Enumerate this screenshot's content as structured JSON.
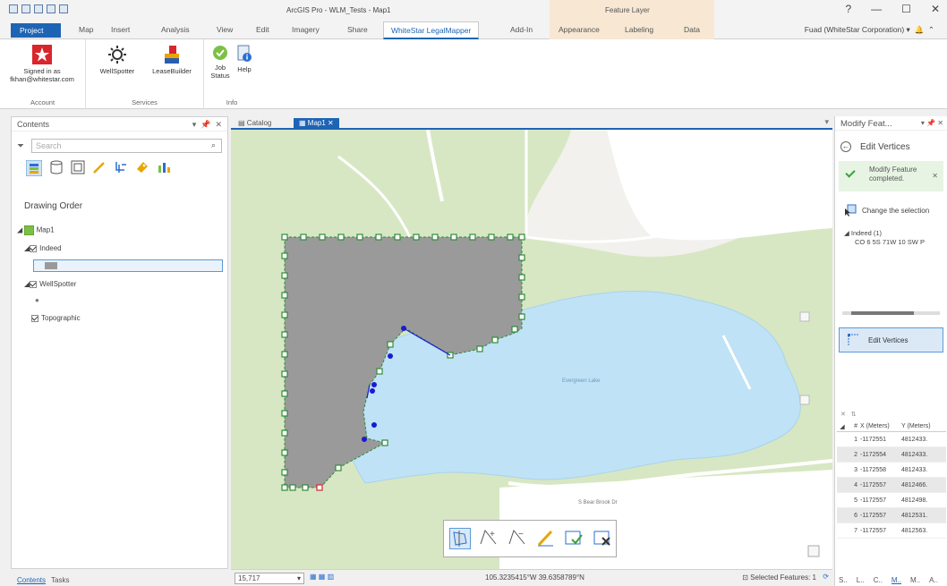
{
  "app": {
    "title": "ArcGIS Pro - WLM_Tests - Map1",
    "context_tab_group": "Feature Layer",
    "user": "Fuad (WhiteStar Corporation)",
    "window_buttons": [
      "?",
      "—",
      "☐",
      "✕"
    ]
  },
  "ribbon": {
    "tabs": [
      "Project",
      "Map",
      "Insert",
      "Analysis",
      "View",
      "Edit",
      "Imagery",
      "Share",
      "WhiteStar LegalMapper",
      "Add-In",
      "Appearance",
      "Labeling",
      "Data"
    ],
    "active_tab": "WhiteStar LegalMapper",
    "groups": {
      "account": {
        "label": "Account",
        "signed_in": "Signed in as",
        "email": "fkhan@whitestar.com"
      },
      "services": {
        "label": "Services",
        "wellspotter": "WellSpotter",
        "leasebuilder": "LeaseBuilder"
      },
      "info": {
        "label": "Info",
        "job_status": "Job Status",
        "help": "Help"
      }
    }
  },
  "contents": {
    "title": "Contents",
    "search_placeholder": "Search",
    "section": "Drawing Order",
    "layers": {
      "map": "Map1",
      "indeed": "Indeed",
      "wellspotter": "WellSpotter",
      "topographic": "Topographic"
    },
    "bottom_tabs": [
      "Contents",
      "Tasks"
    ]
  },
  "map": {
    "tabs": [
      "Catalog",
      "Map1"
    ],
    "active_tab": "Map1",
    "lake_label": "Evergreen Lake",
    "road_label": "S Bear Brook Dr"
  },
  "statusbar": {
    "scale": "15,717",
    "coords": "105.3235415°W 39.6358789°N",
    "selected": "Selected Features: 1"
  },
  "modify": {
    "title": "Modify Feat...",
    "tool": "Edit Vertices",
    "message": "Modify Feature completed.",
    "change_selection": "Change the selection",
    "tree_label": "Indeed (1)",
    "tree_value": "CO 6 5S 71W 10 SW P",
    "edit_button": "Edit Vertices",
    "grid": {
      "headers": [
        "#",
        "X (Meters)",
        "Y (Meters)"
      ],
      "rows": [
        [
          "1",
          "-1172551",
          "4812433."
        ],
        [
          "2",
          "-1172554",
          "4812433."
        ],
        [
          "3",
          "-1172558",
          "4812433."
        ],
        [
          "4",
          "-1172557",
          "4812466."
        ],
        [
          "5",
          "-1172557",
          "4812498."
        ],
        [
          "6",
          "-1172557",
          "4812531."
        ],
        [
          "7",
          "-1172557",
          "4812563."
        ]
      ]
    },
    "bottom_tabs": [
      "S..",
      "L..",
      "C..",
      "M..",
      "M..",
      "A.."
    ]
  },
  "colors": {
    "accent": "#1e64b4",
    "parkland": "#d7e7c3",
    "water": "#bfe2f6",
    "polygon_fill": "#9a9a9a",
    "vertex_green": "#2e8b3a",
    "vertex_blue": "#1a1ad0"
  }
}
